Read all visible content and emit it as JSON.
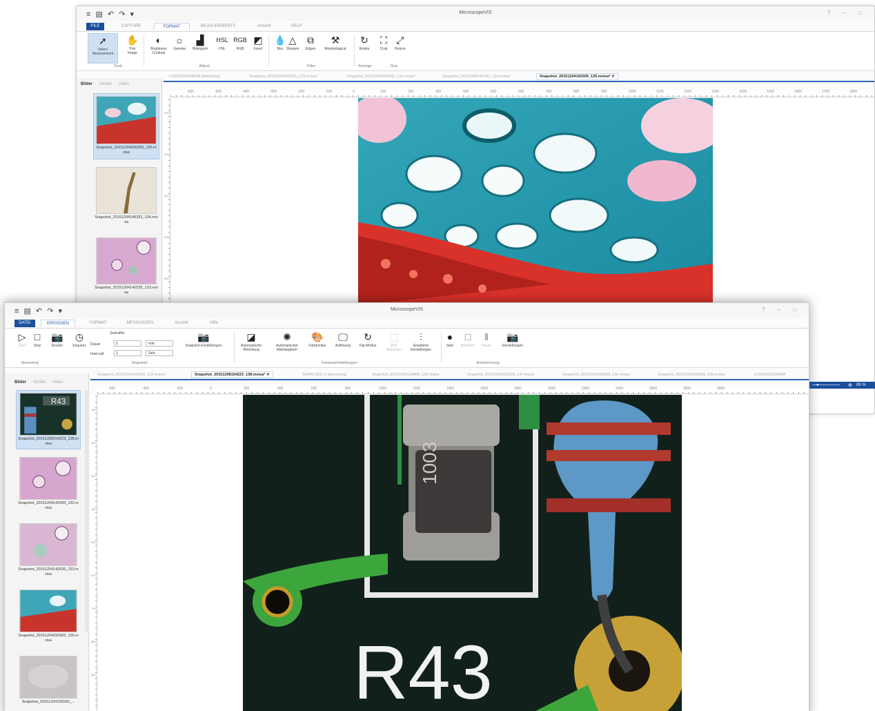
{
  "back_window": {
    "title": "MicroscopeVIS",
    "tabs": [
      "FILE",
      "CAPTURE",
      "FORMAT",
      "MEASUREMENTS",
      "Ansicht",
      "HELP"
    ],
    "active_tab": "FORMAT",
    "tools": [
      {
        "label": "Select\nMeasurement",
        "icon": "cursor-icon"
      },
      {
        "label": "Pan\nImage",
        "icon": "hand-icon"
      },
      {
        "label": "Brightness\nContrast",
        "icon": "brightness-icon"
      },
      {
        "label": "Gamma",
        "icon": "gamma-icon"
      },
      {
        "label": "Histogram",
        "icon": "histogram-icon"
      },
      {
        "label": "HSL",
        "icon": "hsl-icon"
      },
      {
        "label": "RGB",
        "icon": "rgb-icon"
      },
      {
        "label": "Invert",
        "icon": "invert-icon"
      },
      {
        "label": "Blur",
        "icon": "blur-icon"
      },
      {
        "label": "Sharpen",
        "icon": "sharpen-icon"
      },
      {
        "label": "Edges",
        "icon": "edges-icon"
      },
      {
        "label": "Morphological",
        "icon": "morph-icon"
      },
      {
        "label": "Rotate",
        "icon": "rotate-icon"
      },
      {
        "label": "Crop",
        "icon": "crop-icon"
      },
      {
        "label": "Resize",
        "icon": "resize-icon"
      }
    ],
    "groups": [
      "Tools",
      "Adjust",
      "Filter",
      "Arrange",
      "Size"
    ],
    "side_tabs": [
      "Bilder",
      "Geräte",
      "Video"
    ],
    "thumbnails": [
      "Snapshot_20151204150305_135.mvisa",
      "Snapshot_20151204145332_134.mvisa",
      "Snapshot_20151204142535_133.mvisa"
    ],
    "doc_tabs": [
      "LCMOS03000KPA [streaming]",
      "Snapshot_20151204142535_133.mvisa*",
      "Snapshot_20151204142945_132.mvisa*",
      "Snapshot_20151204145332_134.mvisa*",
      "Snapshot_20151204150305_135.mvisa*"
    ],
    "ruler_ticks": [
      "-600",
      "-500",
      "-400",
      "-300",
      "-200",
      "-100",
      "0",
      "100",
      "200",
      "300",
      "400",
      "500",
      "600",
      "700",
      "800",
      "900",
      "1000",
      "1100",
      "1200",
      "1300",
      "1400",
      "1500",
      "1600",
      "1700",
      "1800"
    ],
    "ruler_ticks_v": [
      "100",
      "200",
      "300",
      "400",
      "500",
      "600",
      "700"
    ]
  },
  "front_window": {
    "title": "MicroscopeVIS",
    "tabs": [
      "DATEI",
      "ERFASSEN",
      "FORMAT",
      "MESSUNGEN",
      "Ansicht",
      "Hilfe"
    ],
    "active_tab": "ERFASSEN",
    "stream_buttons": [
      {
        "label": "Start",
        "icon": "play-icon"
      },
      {
        "label": "Stop",
        "icon": "stop-icon"
      },
      {
        "label": "Einzeln",
        "icon": "camera-icon"
      },
      {
        "label": "Sequenz",
        "icon": "clock-icon"
      }
    ],
    "interval": {
      "header": "Zeitraffer",
      "dauer_label": "Dauer",
      "dauer_value": "1",
      "dauer_unit": "min",
      "intervall_label": "Intervall",
      "intervall_value": "1",
      "intervall_unit": "Sek"
    },
    "snapshot_settings": "Snapshot-Einstellungen",
    "camera_buttons": [
      {
        "label": "Automatische\nBelichtung",
        "icon": "exposure-icon",
        "disabled": false
      },
      {
        "label": "Automatischer\nWeißabgleich",
        "icon": "whitebalance-icon",
        "disabled": false
      },
      {
        "label": "Farbmodus",
        "icon": "colormode-icon",
        "disabled": false
      },
      {
        "label": "Auflösung",
        "icon": "resolution-icon",
        "disabled": false
      },
      {
        "label": "Flip-Modus",
        "icon": "flip-icon",
        "disabled": false
      },
      {
        "label": "ROI\nAktivieren",
        "icon": "roi-icon",
        "disabled": true
      },
      {
        "label": "Erweiterte\nEinstellungen",
        "icon": "sliders-icon",
        "disabled": false
      }
    ],
    "record_buttons": [
      {
        "label": "Start",
        "icon": "record-icon",
        "disabled": false
      },
      {
        "label": "Beenden",
        "icon": "stop-icon",
        "disabled": true
      },
      {
        "label": "Pause",
        "icon": "pause-icon",
        "disabled": true
      },
      {
        "label": "Einstellungen",
        "icon": "camera-settings-icon",
        "disabled": false
      }
    ],
    "groups": [
      "Streaming",
      "Snapshot",
      "Kameraeinstellungen",
      "Aufzeichnung"
    ],
    "side_tabs": [
      "Bilder",
      "Geräte",
      "Video"
    ],
    "thumbnails": [
      "Snapshot_20151208154223_138.mvisa",
      "Snapshot_20151204142500_132.mvisa",
      "Snapshot_20151204142535_133.mvisa",
      "Snapshot_20151204150305_135.mvisa",
      "Snapshot_20151204155550_..."
    ],
    "doc_tabs": [
      "Snapshot_20151204142500_132.mvisa*",
      "Snapshot_20151208154223_138.mvisa*",
      "KERN ODC-2 [streaming]",
      "Snapshot_20151204134909_135.mvisa",
      "Snapshot_20151204160520_137.mvisa",
      "Snapshot_20151204155558_136.mvisa",
      "Snapshot_20151204150305_135.mvisa",
      "LCMOS03000KPA"
    ],
    "ruler_ticks": [
      "-600",
      "-400",
      "-200",
      "0",
      "200",
      "400",
      "600",
      "800",
      "1000",
      "1200",
      "1400",
      "1600",
      "1800",
      "2000",
      "2200",
      "2400",
      "2600",
      "2800",
      "3000"
    ],
    "ruler_ticks_v": [
      "100",
      "200",
      "300",
      "400",
      "500",
      "600",
      "700",
      "800",
      "900"
    ],
    "zoom_label": "85 %",
    "board_text": "R43",
    "resistor_marking": "1003"
  }
}
